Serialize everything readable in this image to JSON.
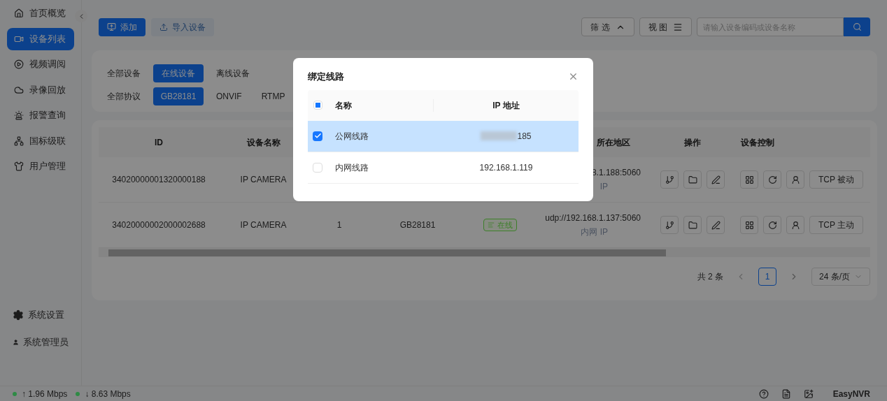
{
  "sidebar": {
    "items": [
      {
        "label": "首页概览",
        "selected": false
      },
      {
        "label": "设备列表",
        "selected": true
      },
      {
        "label": "视频调阅",
        "selected": false
      },
      {
        "label": "录像回放",
        "selected": false
      },
      {
        "label": "报警查询",
        "selected": false
      },
      {
        "label": "国标级联",
        "selected": false
      },
      {
        "label": "用户管理",
        "selected": false
      }
    ],
    "bottom_items": [
      {
        "label": "系统设置"
      },
      {
        "label": "系统管理员"
      }
    ]
  },
  "toolbar": {
    "buttons": [
      {
        "label": "添加",
        "kind": "primary"
      },
      {
        "label": "导入设备",
        "kind": "secondary"
      }
    ],
    "filter_button": "筛 选",
    "view_button": "视 图",
    "search": {
      "placeholder": "请输入设备编码或设备名称"
    }
  },
  "filters": [
    [
      {
        "label": "全部设备",
        "selected": false
      },
      {
        "label": "在线设备",
        "selected": true
      },
      {
        "label": "离线设备",
        "selected": false
      }
    ],
    [
      {
        "label": "全部协议",
        "selected": false
      },
      {
        "label": "GB28181",
        "selected": true
      },
      {
        "label": "ONVIF",
        "selected": false
      },
      {
        "label": "RTMP",
        "selected": false
      }
    ]
  ],
  "table": {
    "columns": {
      "id": "ID",
      "name": "设备名称",
      "address": "所在地区",
      "actions": "操作",
      "control": "设备控制"
    },
    "rows": [
      {
        "id": "34020000001320000188",
        "name": "IP CAMERA",
        "address": "8.1.188:5060",
        "network": "IP",
        "control": "TCP 被动"
      },
      {
        "id": "34020000002000002688",
        "name": "IP CAMERA",
        "column_3": "1",
        "column_4": "GB28181",
        "status": {
          "label": "在线",
          "color": "#3d7f2a"
        },
        "address": "udp://192.168.1.137:5060",
        "network": "内网 IP",
        "control": "TCP 主动"
      }
    ]
  },
  "pagination": {
    "total": "共 2 条",
    "pages": [
      {
        "label": "1",
        "selected": true
      }
    ],
    "page_size": "24 条/页"
  },
  "status_bar": {
    "rates": [
      {
        "text": "↑ 1.96 Mbps",
        "color": "#2e8b45"
      },
      {
        "text": "↓ 8.63 Mbps",
        "color": "#2e8b45"
      }
    ],
    "brand": "EasyNVR"
  },
  "dialog": {
    "title": "绑定线路",
    "columns": [
      "名称",
      "IP 地址"
    ],
    "header_checkbox": {
      "indeterminate": true
    },
    "rows": [
      {
        "name": "公网线路",
        "ip": "185",
        "redacted": true,
        "checked": true,
        "selected": true
      },
      {
        "name": "内网线路",
        "ip": "192.168.1.119",
        "redacted": false,
        "checked": false,
        "selected": false
      }
    ]
  }
}
